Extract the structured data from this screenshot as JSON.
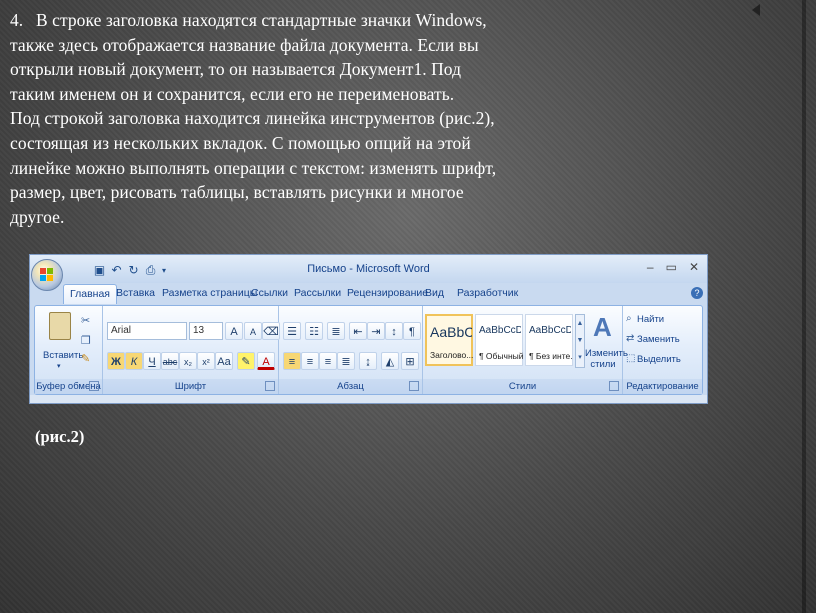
{
  "slide": {
    "paragraph_number": "4.",
    "paragraph_lines": [
      "В строке заголовка находятся стандартные значки Windows,",
      "также здесь отображается название файла документа. Если вы",
      "открыли новый документ, то он называется Документ1. Под",
      "таким именем он и сохранится, если его не переименовать.",
      "Под строкой заголовка находится линейка инструментов (рис.2),",
      "состоящая из нескольких вкладок. С помощью опций на этой",
      "линейке можно выполнять операции с текстом: изменять шрифт,",
      "размер, цвет, рисовать таблицы, вставлять рисунки и многое",
      "другое."
    ],
    "caption": "(рис.2)"
  },
  "word": {
    "title": "Письмо - Microsoft Word",
    "window_controls": [
      "–",
      "▭",
      "✕"
    ],
    "help": "?",
    "tabs": [
      "Главная",
      "Вставка",
      "Разметка страницы",
      "Ссылки",
      "Рассылки",
      "Рецензирование",
      "Вид",
      "Разработчик"
    ],
    "active_tab": "Главная",
    "clipboard": {
      "label": "Буфер обмена",
      "paste": "Вставить"
    },
    "font": {
      "label": "Шрифт",
      "font_name": "Arial",
      "font_size": "13"
    },
    "paragraph": {
      "label": "Абзац"
    },
    "styles": {
      "label": "Стили",
      "items": [
        {
          "sample": "AaBbCc",
          "name": "Заголово..."
        },
        {
          "sample": "AaBbCcDc",
          "name": "¶ Обычный"
        },
        {
          "sample": "AaBbCcDc",
          "name": "¶ Без инте..."
        }
      ],
      "change_styles": "Изменить стили"
    },
    "editing": {
      "label": "Редактирование",
      "find": "Найти",
      "replace": "Заменить",
      "select": "Выделить"
    }
  },
  "colors": {
    "ribbon_text": "#15428b",
    "slide_text": "#ffffff"
  }
}
